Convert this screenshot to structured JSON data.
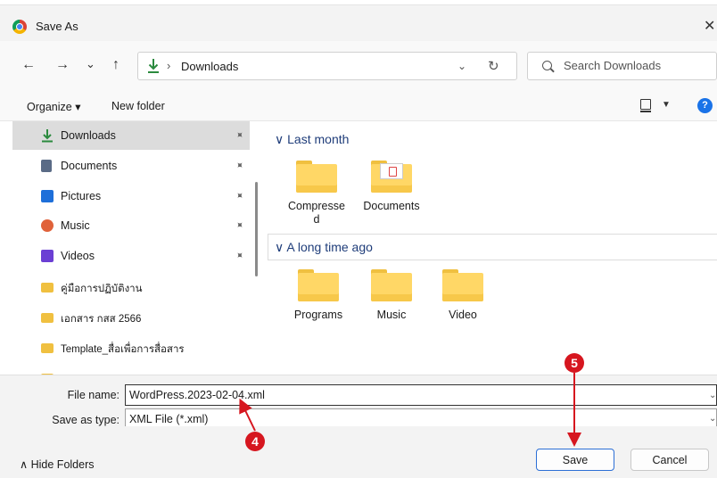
{
  "window": {
    "title": "Save As",
    "close_glyph": "✕"
  },
  "nav": {
    "back": "←",
    "forward": "→",
    "recent": "⌄",
    "up": "↑"
  },
  "address": {
    "separator": "›",
    "current": "Downloads",
    "dropdown": "⌄",
    "refresh": "↻"
  },
  "search": {
    "placeholder": "Search Downloads"
  },
  "commands": {
    "organize": "Organize ▾",
    "new_folder": "New folder",
    "help": "?"
  },
  "sidebar": {
    "items": [
      {
        "label": "Downloads",
        "icon": "download-icon",
        "pinned": true,
        "active": true,
        "color": "#2b8a3e"
      },
      {
        "label": "Documents",
        "icon": "documents-icon",
        "pinned": true,
        "color": "#5a6b86"
      },
      {
        "label": "Pictures",
        "icon": "pictures-icon",
        "pinned": true,
        "color": "#1e6fd9"
      },
      {
        "label": "Music",
        "icon": "music-icon",
        "pinned": true,
        "color": "#e0623a"
      },
      {
        "label": "Videos",
        "icon": "videos-icon",
        "pinned": true,
        "color": "#6b3fd4"
      },
      {
        "label": "คู่มือการปฏิบัติงาน",
        "icon": "folder-icon",
        "pinned": false,
        "color": "#f0c040"
      },
      {
        "label": "เอกสาร กสส 2566",
        "icon": "folder-icon",
        "pinned": false,
        "color": "#f0c040"
      },
      {
        "label": "Template_สื่อเพื่อการสื่อสาร",
        "icon": "folder-icon",
        "pinned": false,
        "color": "#f0c040"
      }
    ],
    "pin_glyph": "📌"
  },
  "groups": [
    {
      "title": "Last month",
      "chevron": "∨",
      "items": [
        {
          "label": "Compresse\nd"
        },
        {
          "label": "Documents"
        }
      ]
    },
    {
      "title": "A long time ago",
      "chevron": "∨",
      "items": [
        {
          "label": "Programs"
        },
        {
          "label": "Music"
        },
        {
          "label": "Video"
        }
      ]
    }
  ],
  "fields": {
    "file_name_label": "File name:",
    "file_name_value": "WordPress.2023-02-04.xml",
    "save_type_label": "Save as type:",
    "save_type_value": "XML File (*.xml)"
  },
  "footer": {
    "hide_folders": "∧  Hide Folders",
    "save": "Save",
    "cancel": "Cancel"
  },
  "annotations": {
    "step4": "4",
    "step5": "5",
    "color": "#d6161f"
  }
}
